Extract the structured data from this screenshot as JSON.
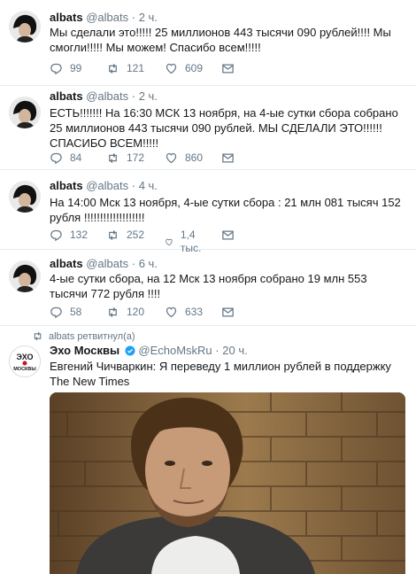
{
  "tweets": [
    {
      "name": "albats",
      "handle": "@albats",
      "time": "2 ч.",
      "text": "Мы сделали это!!!!! 25 миллионов 443 тысячи 090 рублей!!!! Мы смогли!!!!! Мы можем! Спасибо всем!!!!!",
      "replies": "99",
      "retweets": "121",
      "likes": "609"
    },
    {
      "name": "albats",
      "handle": "@albats",
      "time": "2 ч.",
      "text": "ЕСТЬ!!!!!!! На 16:30 МСК 13 ноября, на 4-ые сутки сбора собрано  25 миллионов 443 тысячи 090 рублей. МЫ СДЕЛАЛИ ЭТО!!!!!! СПАСИБО ВСЕМ!!!!!",
      "replies": "84",
      "retweets": "172",
      "likes": "860"
    },
    {
      "name": "albats",
      "handle": "@albats",
      "time": "4 ч.",
      "text": "На 14:00 Мск 13 ноября, 4-ые сутки сбора : 21 млн 081 тысяч 152 рубля !!!!!!!!!!!!!!!!!!!",
      "replies": "132",
      "retweets": "252",
      "likes": "1,4 тыс."
    },
    {
      "name": "albats",
      "handle": "@albats",
      "time": "6 ч.",
      "text": "4-ые сутки сбора, на 12 Мск 13 ноября собрано 19 млн 553 тысячи 772 рубля !!!!",
      "replies": "58",
      "retweets": "120",
      "likes": "633"
    }
  ],
  "retweet": {
    "label": "albats ретвитнул(а)",
    "name": "Эхо Москвы",
    "handle": "@EchoMskRu",
    "time": "20 ч.",
    "text": "Евгений Чичваркин: Я переведу 1 миллион рублей в поддержку The New Times",
    "logo_top": "ЭХО",
    "logo_bottom": "МОСКВЫ"
  },
  "colors": {
    "text": "#14171a",
    "muted": "#657786",
    "border": "#e6ecf0",
    "verified": "#1da1f2",
    "logo_red": "#c4161c"
  },
  "icons": [
    "reply-icon",
    "retweet-icon",
    "like-icon",
    "direct-message-icon",
    "verified-icon"
  ]
}
